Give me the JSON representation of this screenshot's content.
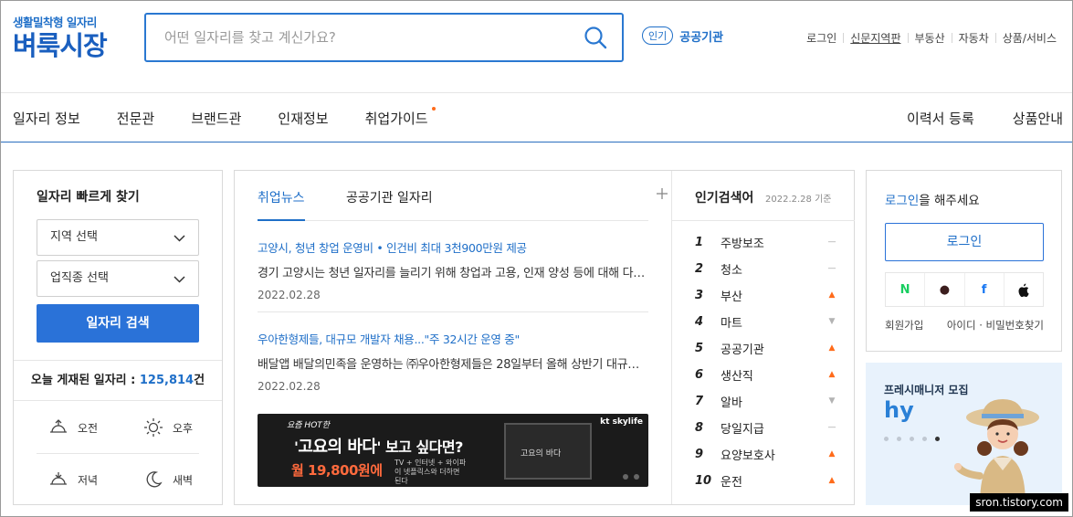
{
  "logo": {
    "tagline": "생활밀착형 일자리",
    "name": "벼룩시장"
  },
  "search": {
    "placeholder": "어떤 일자리를 찾고 계신가요?"
  },
  "popular": {
    "badge": "인기",
    "keyword": "공공기관"
  },
  "toplinks": [
    "로그인",
    "신문지역판",
    "부동산",
    "자동차",
    "상품/서비스"
  ],
  "nav": {
    "left": [
      "일자리 정보",
      "전문관",
      "브랜드관",
      "인재정보",
      "취업가이드"
    ],
    "right": [
      "이력서 등록",
      "상품안내"
    ]
  },
  "quick": {
    "title": "일자리 빠르게 찾기",
    "region_select": "지역 선택",
    "job_select": "업직종 선택",
    "search_button": "일자리 검색",
    "today_label": "오늘 게재된 일자리 : ",
    "today_count": "125,814",
    "today_unit": "건",
    "times": [
      "오전",
      "오후",
      "저녁",
      "새벽"
    ]
  },
  "center": {
    "tabs": [
      "취업뉴스",
      "공공기관 일자리"
    ],
    "news": [
      {
        "title": "고양시, 청년 창업 운영비 • 인건비 최대 3천900만원 제공",
        "desc": "경기 고양시는 청년 일자리를 늘리기 위해 창업과 고용, 인재 양성 등에 대해 다양한 지원을 합니다",
        "date": "2022.02.28"
      },
      {
        "title": "우아한형제들, 대규모 개발자 채용...\"주 32시간 운영 중\"",
        "desc": "배달앱 배달의민족을 운영하는 ㈜우아한형제들은 28일부터 올해 상반기 대규모 개발자 채용을 진행합니다",
        "date": "2022.02.28"
      }
    ],
    "banner": {
      "small": "요즘 HOT한",
      "main_prefix": "'",
      "main_highlight": "고요의 바다",
      "main_suffix": "' 보고 싶다면?",
      "price": "월 19,800원에",
      "sub": "TV + 인터넷 + 와이파이 넷플릭스와 더하면 된다",
      "brand": "kt skylife",
      "tv_text": "고요의 바다"
    }
  },
  "ranks": {
    "title": "인기검색어",
    "date": "2022.2.28 기준",
    "items": [
      {
        "n": "1",
        "word": "주방보조",
        "trend": "same"
      },
      {
        "n": "2",
        "word": "청소",
        "trend": "same"
      },
      {
        "n": "3",
        "word": "부산",
        "trend": "up"
      },
      {
        "n": "4",
        "word": "마트",
        "trend": "down"
      },
      {
        "n": "5",
        "word": "공공기관",
        "trend": "up"
      },
      {
        "n": "6",
        "word": "생산직",
        "trend": "up"
      },
      {
        "n": "7",
        "word": "알바",
        "trend": "down"
      },
      {
        "n": "8",
        "word": "당일지급",
        "trend": "same"
      },
      {
        "n": "9",
        "word": "요양보호사",
        "trend": "up"
      },
      {
        "n": "10",
        "word": "운전",
        "trend": "up"
      }
    ],
    "symbols": {
      "up": "▲",
      "down": "▼",
      "same": "—"
    }
  },
  "login": {
    "msg_link": "로그인",
    "msg_rest": "을 해주세요",
    "button": "로그인",
    "socials": [
      {
        "icon": "naver-icon",
        "glyph": "N",
        "color": "#19ce60"
      },
      {
        "icon": "kakao-icon",
        "glyph": "●",
        "color": "#3c1e1e"
      },
      {
        "icon": "facebook-icon",
        "glyph": "f",
        "color": "#1877f2"
      },
      {
        "icon": "apple-icon",
        "glyph": "",
        "color": "#111111"
      }
    ],
    "signup": "회원가입",
    "find": "아이디 · 비밀번호찾기"
  },
  "ad": {
    "title": "프레시매니저 모집",
    "logo": "hy"
  },
  "watermark": "sron.tistory.com"
}
